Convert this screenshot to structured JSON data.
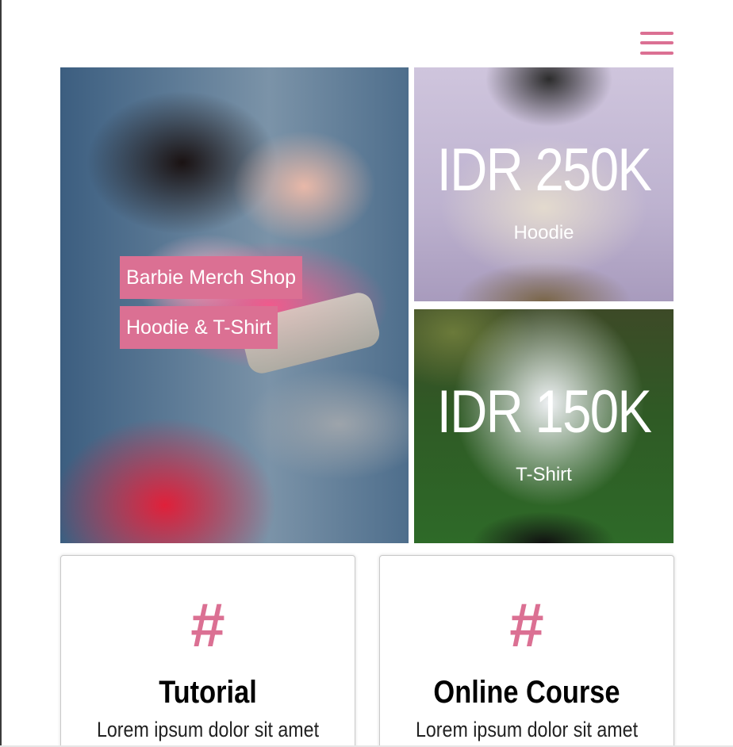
{
  "header": {
    "menu_icon": "hamburger-menu-icon"
  },
  "hero": {
    "main": {
      "tag_1": "Barbie Merch Shop",
      "tag_2": "Hoodie & T-Shirt"
    },
    "products": [
      {
        "price": "IDR 250K",
        "name": "Hoodie"
      },
      {
        "price": "IDR 150K",
        "name": "T-Shirt"
      }
    ]
  },
  "cards": [
    {
      "icon": "#",
      "title": "Tutorial",
      "text": "Lorem ipsum dolor sit amet"
    },
    {
      "icon": "#",
      "title": "Online Course",
      "text": "Lorem ipsum dolor sit amet"
    }
  ],
  "colors": {
    "accent": "#db7093",
    "text": "#000000",
    "white": "#ffffff"
  }
}
